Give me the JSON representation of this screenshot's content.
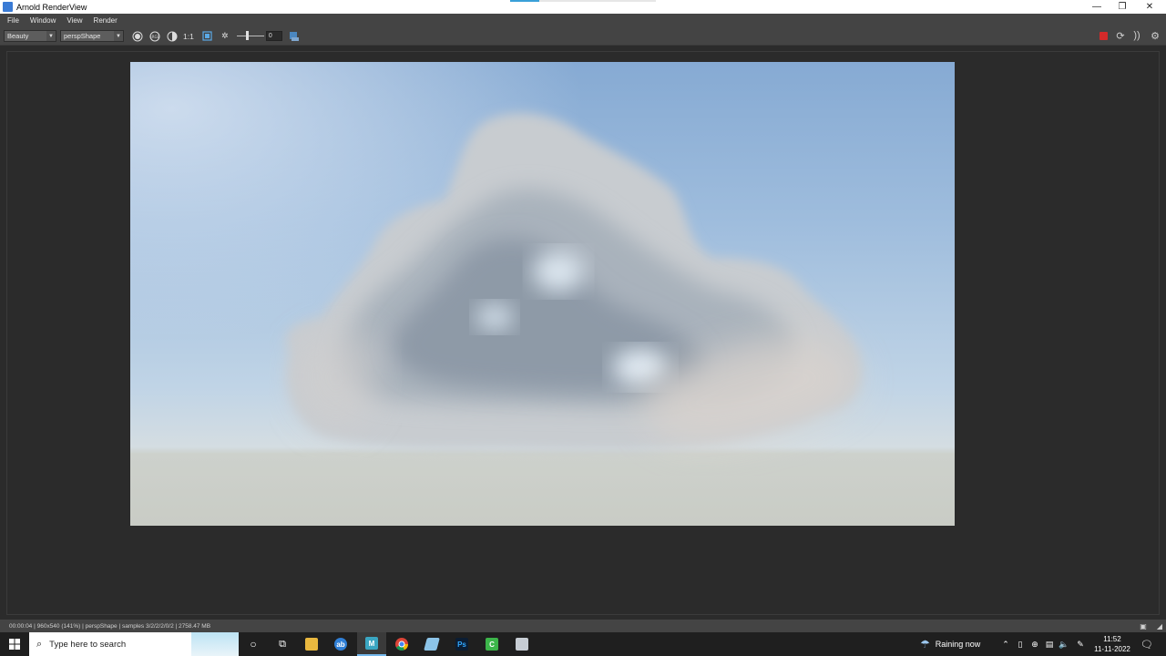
{
  "window": {
    "title": "Arnold RenderView",
    "minimize": "—",
    "restore": "❐",
    "close": "✕"
  },
  "menu": [
    "File",
    "Window",
    "View",
    "Render"
  ],
  "toolbar": {
    "aov": "Beauty",
    "camera": "perspShape",
    "ratio_label": "1:1",
    "exposure_value": "0"
  },
  "status": {
    "text": "00:00:04 | 960x540 (141%) | perspShape  | samples 3/2/2/2/0/2 | 2758.47 MB"
  },
  "taskbar": {
    "search_placeholder": "Type here to search",
    "weather": "Raining now",
    "time": "11:52",
    "date": "11-11-2022",
    "apps": [
      {
        "name": "cortana",
        "glyph": "○"
      },
      {
        "name": "task-view",
        "glyph": "⧉"
      },
      {
        "name": "file-explorer",
        "glyph": ""
      },
      {
        "name": "browser",
        "glyph": "ab"
      },
      {
        "name": "maya",
        "glyph": "M"
      },
      {
        "name": "chrome",
        "glyph": ""
      },
      {
        "name": "app-feather",
        "glyph": ""
      },
      {
        "name": "photoshop",
        "glyph": "Ps"
      },
      {
        "name": "camtasia",
        "glyph": "C"
      },
      {
        "name": "app-window",
        "glyph": ""
      }
    ]
  },
  "colors": {
    "panel": "#444444",
    "viewport": "#2b2b2b",
    "stop": "#d42a2a",
    "taskbar": "#1f1f1f",
    "taskbar_active_line": "#76b9ed"
  }
}
